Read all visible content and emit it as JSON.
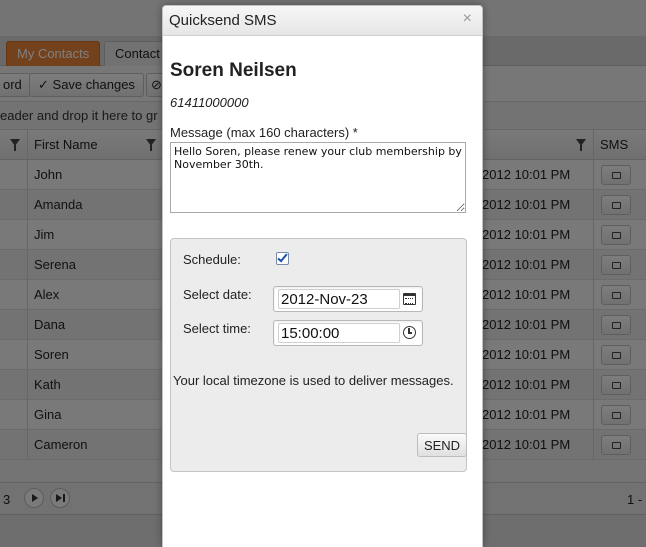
{
  "background": {
    "tabs": [
      {
        "label": "My Contacts",
        "active": true
      },
      {
        "label": "Contact",
        "active": false
      }
    ],
    "toolbar": {
      "record_label": "ord",
      "save_label": "Save changes"
    },
    "group_hint": "eader and drop it here to gr",
    "columns": {
      "first_name": "First Name",
      "sms": "SMS"
    },
    "rows": [
      {
        "first_name": "John",
        "date": "2012 10:01 PM"
      },
      {
        "first_name": "Amanda",
        "date": "2012 10:01 PM"
      },
      {
        "first_name": "Jim",
        "date": "2012 10:01 PM"
      },
      {
        "first_name": "Serena",
        "date": "2012 10:01 PM"
      },
      {
        "first_name": "Alex",
        "date": "2012 10:01 PM"
      },
      {
        "first_name": "Dana",
        "date": "2012 10:01 PM"
      },
      {
        "first_name": "Soren",
        "date": "2012 10:01 PM"
      },
      {
        "first_name": "Kath",
        "date": "2012 10:01 PM"
      },
      {
        "first_name": "Gina",
        "date": "2012 10:01 PM"
      },
      {
        "first_name": "Cameron",
        "date": "2012 10:01 PM"
      }
    ],
    "pager": {
      "page": "3",
      "info": "1 -"
    }
  },
  "modal": {
    "title": "Quicksend SMS",
    "close_glyph": "×",
    "contact_name": "Soren Neilsen",
    "phone": "61411000000",
    "message_label": "Message (max 160 characters) *",
    "message_value": "Hello Soren, please renew your club membership by November 30th.",
    "schedule_label": "Schedule:",
    "schedule_checked": true,
    "date_label": "Select date:",
    "date_value": "2012-Nov-23",
    "time_label": "Select time:",
    "time_value": "15:00:00",
    "timezone_note": "Your local timezone is used to deliver messages.",
    "send_label": "SEND"
  },
  "colors": {
    "active_tab": "#e8833a",
    "overlay": "rgba(0,0,0,0.5)",
    "checkbox_tick": "#1a4fa8"
  }
}
